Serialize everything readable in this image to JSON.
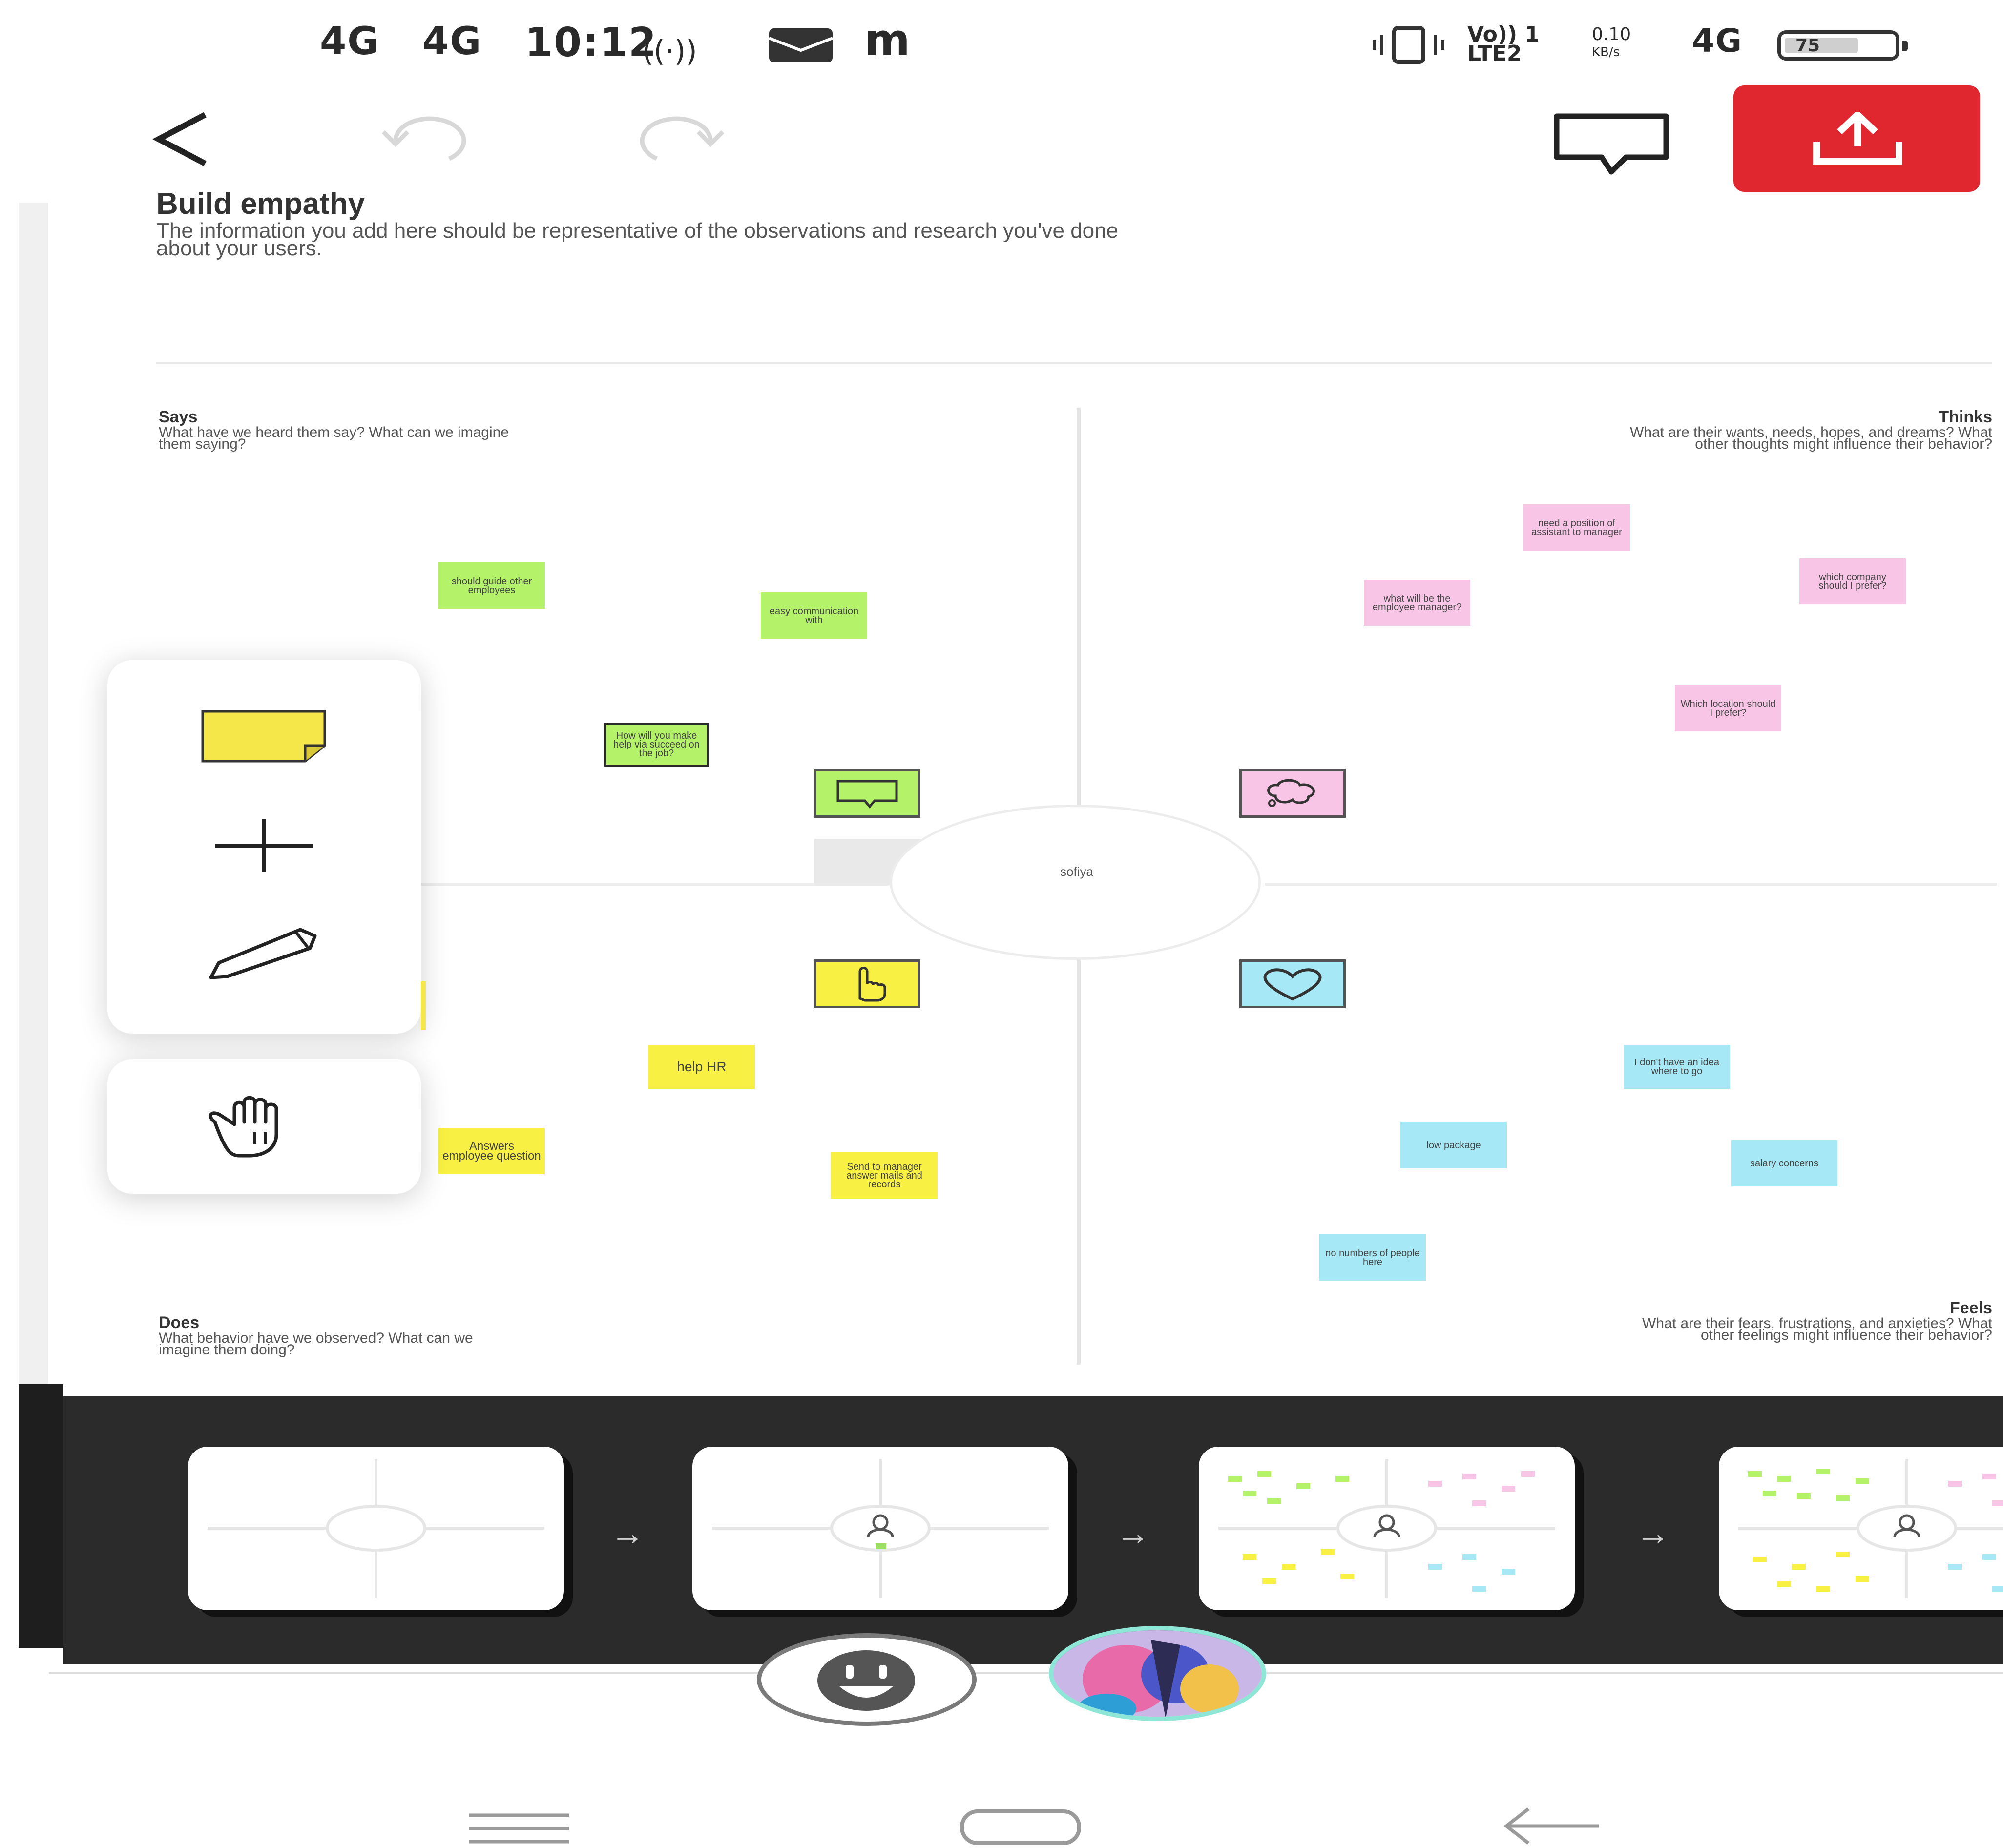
{
  "status_bar": {
    "network1": "4G",
    "network2": "4G",
    "time": "10:12",
    "app_letter": "m",
    "volte_top": "Vo)) 1",
    "volte_bottom": "LTE2",
    "speed_value": "0.10",
    "speed_unit": "KB/s",
    "network3": "4G",
    "battery": "75"
  },
  "toolbar": {
    "back_icon": "chevron-left-icon",
    "undo_icon": "undo-icon",
    "redo_icon": "redo-icon",
    "comment_icon": "comment-icon",
    "share_icon": "upload-icon",
    "share_color": "#e0262e"
  },
  "board": {
    "title": "Build empathy",
    "description": "The information you add here should be representative of the observations and research you've done about your users.",
    "center_label": "sofiya",
    "quadrants": {
      "says": {
        "title": "Says",
        "subtitle": "What have we heard them say? What can we imagine them saying?"
      },
      "thinks": {
        "title": "Thinks",
        "subtitle": "What are their wants, needs, hopes, and dreams? What other thoughts might influence their behavior?"
      },
      "does": {
        "title": "Does",
        "subtitle": "What behavior have we observed? What can we imagine them doing?"
      },
      "feels": {
        "title": "Feels",
        "subtitle": "What are their fears, frustrations, and anxieties? What other feelings might influence their behavior?"
      }
    },
    "notes": {
      "g1": "should guide other employees",
      "g2": "easy communication with",
      "g3": "How will you make help via succeed on the job?",
      "p1": "need a position of assistant to manager",
      "p2": "what will be the employee manager?",
      "p3": "which company should I prefer?",
      "p4": "Which location should I prefer?",
      "y1": "help HR",
      "y2": "Answers employee question",
      "y3": "Send to manager answer mails and records",
      "b1": "I don't have an idea where to go",
      "b2": "low package",
      "b3": "salary concerns",
      "b4": "no numbers of people here"
    },
    "quadrant_icons": {
      "says": "speech-bubble-icon",
      "thinks": "thought-bubble-icon",
      "does": "pointer-hand-icon",
      "feels": "heart-icon"
    }
  },
  "left_tools": {
    "sticky": "sticky-note-icon",
    "add": "plus-icon",
    "pen": "pencil-icon",
    "hand": "hand-icon"
  },
  "colors": {
    "green_note": "#b4f26a",
    "pink_note": "#f8c5e6",
    "yellow_note": "#f8f143",
    "blue_note": "#a6e8f5"
  },
  "bottom_bar": {
    "emoji_icon": "smiley-icon",
    "avatar": "user-avatar"
  },
  "nav": {
    "menu_icon": "menu-icon",
    "home_icon": "home-icon",
    "back_icon": "back-arrow-icon"
  }
}
